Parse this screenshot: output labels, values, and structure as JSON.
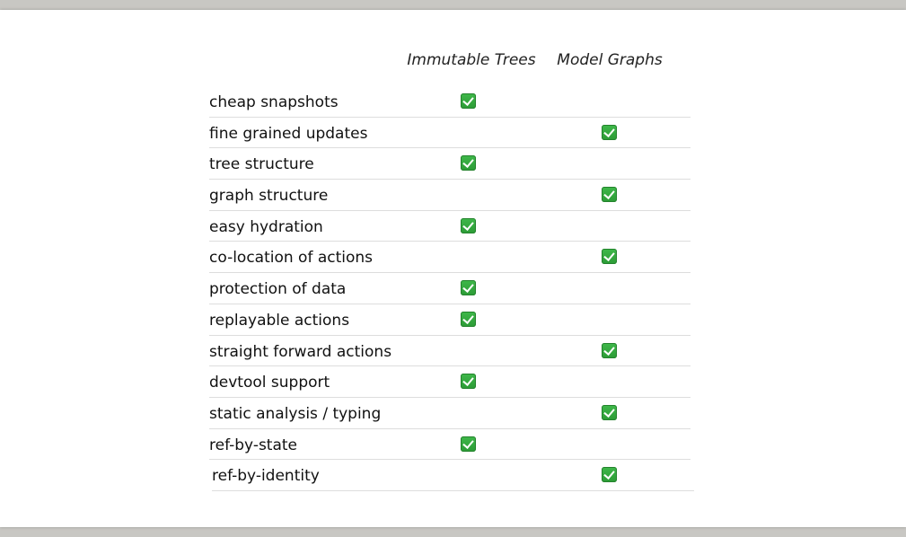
{
  "table": {
    "columns": [
      "Immutable Trees",
      "Model Graphs"
    ],
    "rows": [
      {
        "feature": "cheap snapshots",
        "trees": true,
        "graphs": false
      },
      {
        "feature": "fine grained updates",
        "trees": false,
        "graphs": true
      },
      {
        "feature": "tree structure",
        "trees": true,
        "graphs": false
      },
      {
        "feature": "graph structure",
        "trees": false,
        "graphs": true
      },
      {
        "feature": "easy hydration",
        "trees": true,
        "graphs": false
      },
      {
        "feature": "co-location of actions",
        "trees": false,
        "graphs": true
      },
      {
        "feature": "protection of data",
        "trees": true,
        "graphs": false
      },
      {
        "feature": "replayable actions",
        "trees": true,
        "graphs": false
      },
      {
        "feature": "straight forward actions",
        "trees": false,
        "graphs": true
      },
      {
        "feature": "devtool support",
        "trees": true,
        "graphs": false
      },
      {
        "feature": "static analysis / typing",
        "trees": false,
        "graphs": true
      },
      {
        "feature": "ref-by-state",
        "trees": true,
        "graphs": false
      },
      {
        "feature": "ref-by-identity",
        "trees": false,
        "graphs": true
      }
    ]
  },
  "icons": {
    "check": "check-mark-icon"
  },
  "colors": {
    "check_green": "#2c9b36"
  }
}
